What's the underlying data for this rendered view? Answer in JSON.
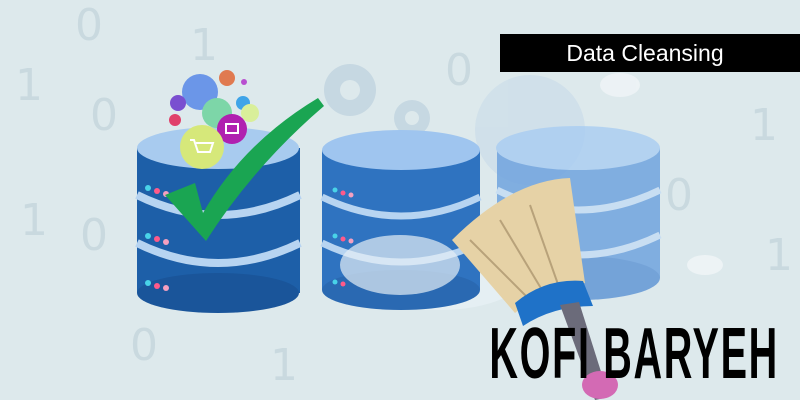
{
  "banner": {
    "title": "Data Cleansing",
    "author": "KOFI BARYEH"
  },
  "background_digits": [
    "0",
    "1",
    "1",
    "0",
    "1",
    "0",
    "0",
    "1",
    "0",
    "1",
    "1",
    "0"
  ],
  "colors": {
    "background": "#dde9ec",
    "db_dark": "#1d5fa8",
    "db_light": "#9cc3ee",
    "check": "#1aa552",
    "broom": "#e6d2a6",
    "title_bg": "#000000"
  }
}
